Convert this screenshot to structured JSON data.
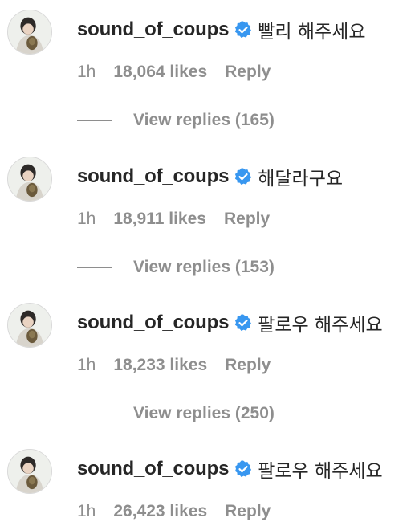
{
  "colors": {
    "text_primary": "#262626",
    "text_secondary": "#8e8e8e",
    "verified_blue": "#3897f0"
  },
  "comments": [
    {
      "username": "sound_of_coups",
      "verified": true,
      "text": "빨리 해주세요",
      "time": "1h",
      "likes": "18,064 likes",
      "reply_label": "Reply",
      "view_replies": "View replies (165)"
    },
    {
      "username": "sound_of_coups",
      "verified": true,
      "text": "해달라구요",
      "time": "1h",
      "likes": "18,911 likes",
      "reply_label": "Reply",
      "view_replies": "View replies (153)"
    },
    {
      "username": "sound_of_coups",
      "verified": true,
      "text": "팔로우 해주세요",
      "time": "1h",
      "likes": "18,233 likes",
      "reply_label": "Reply",
      "view_replies": "View replies (250)"
    },
    {
      "username": "sound_of_coups",
      "verified": true,
      "text": "팔로우 해주세요",
      "time": "1h",
      "likes": "26,423 likes",
      "reply_label": "Reply"
    }
  ]
}
